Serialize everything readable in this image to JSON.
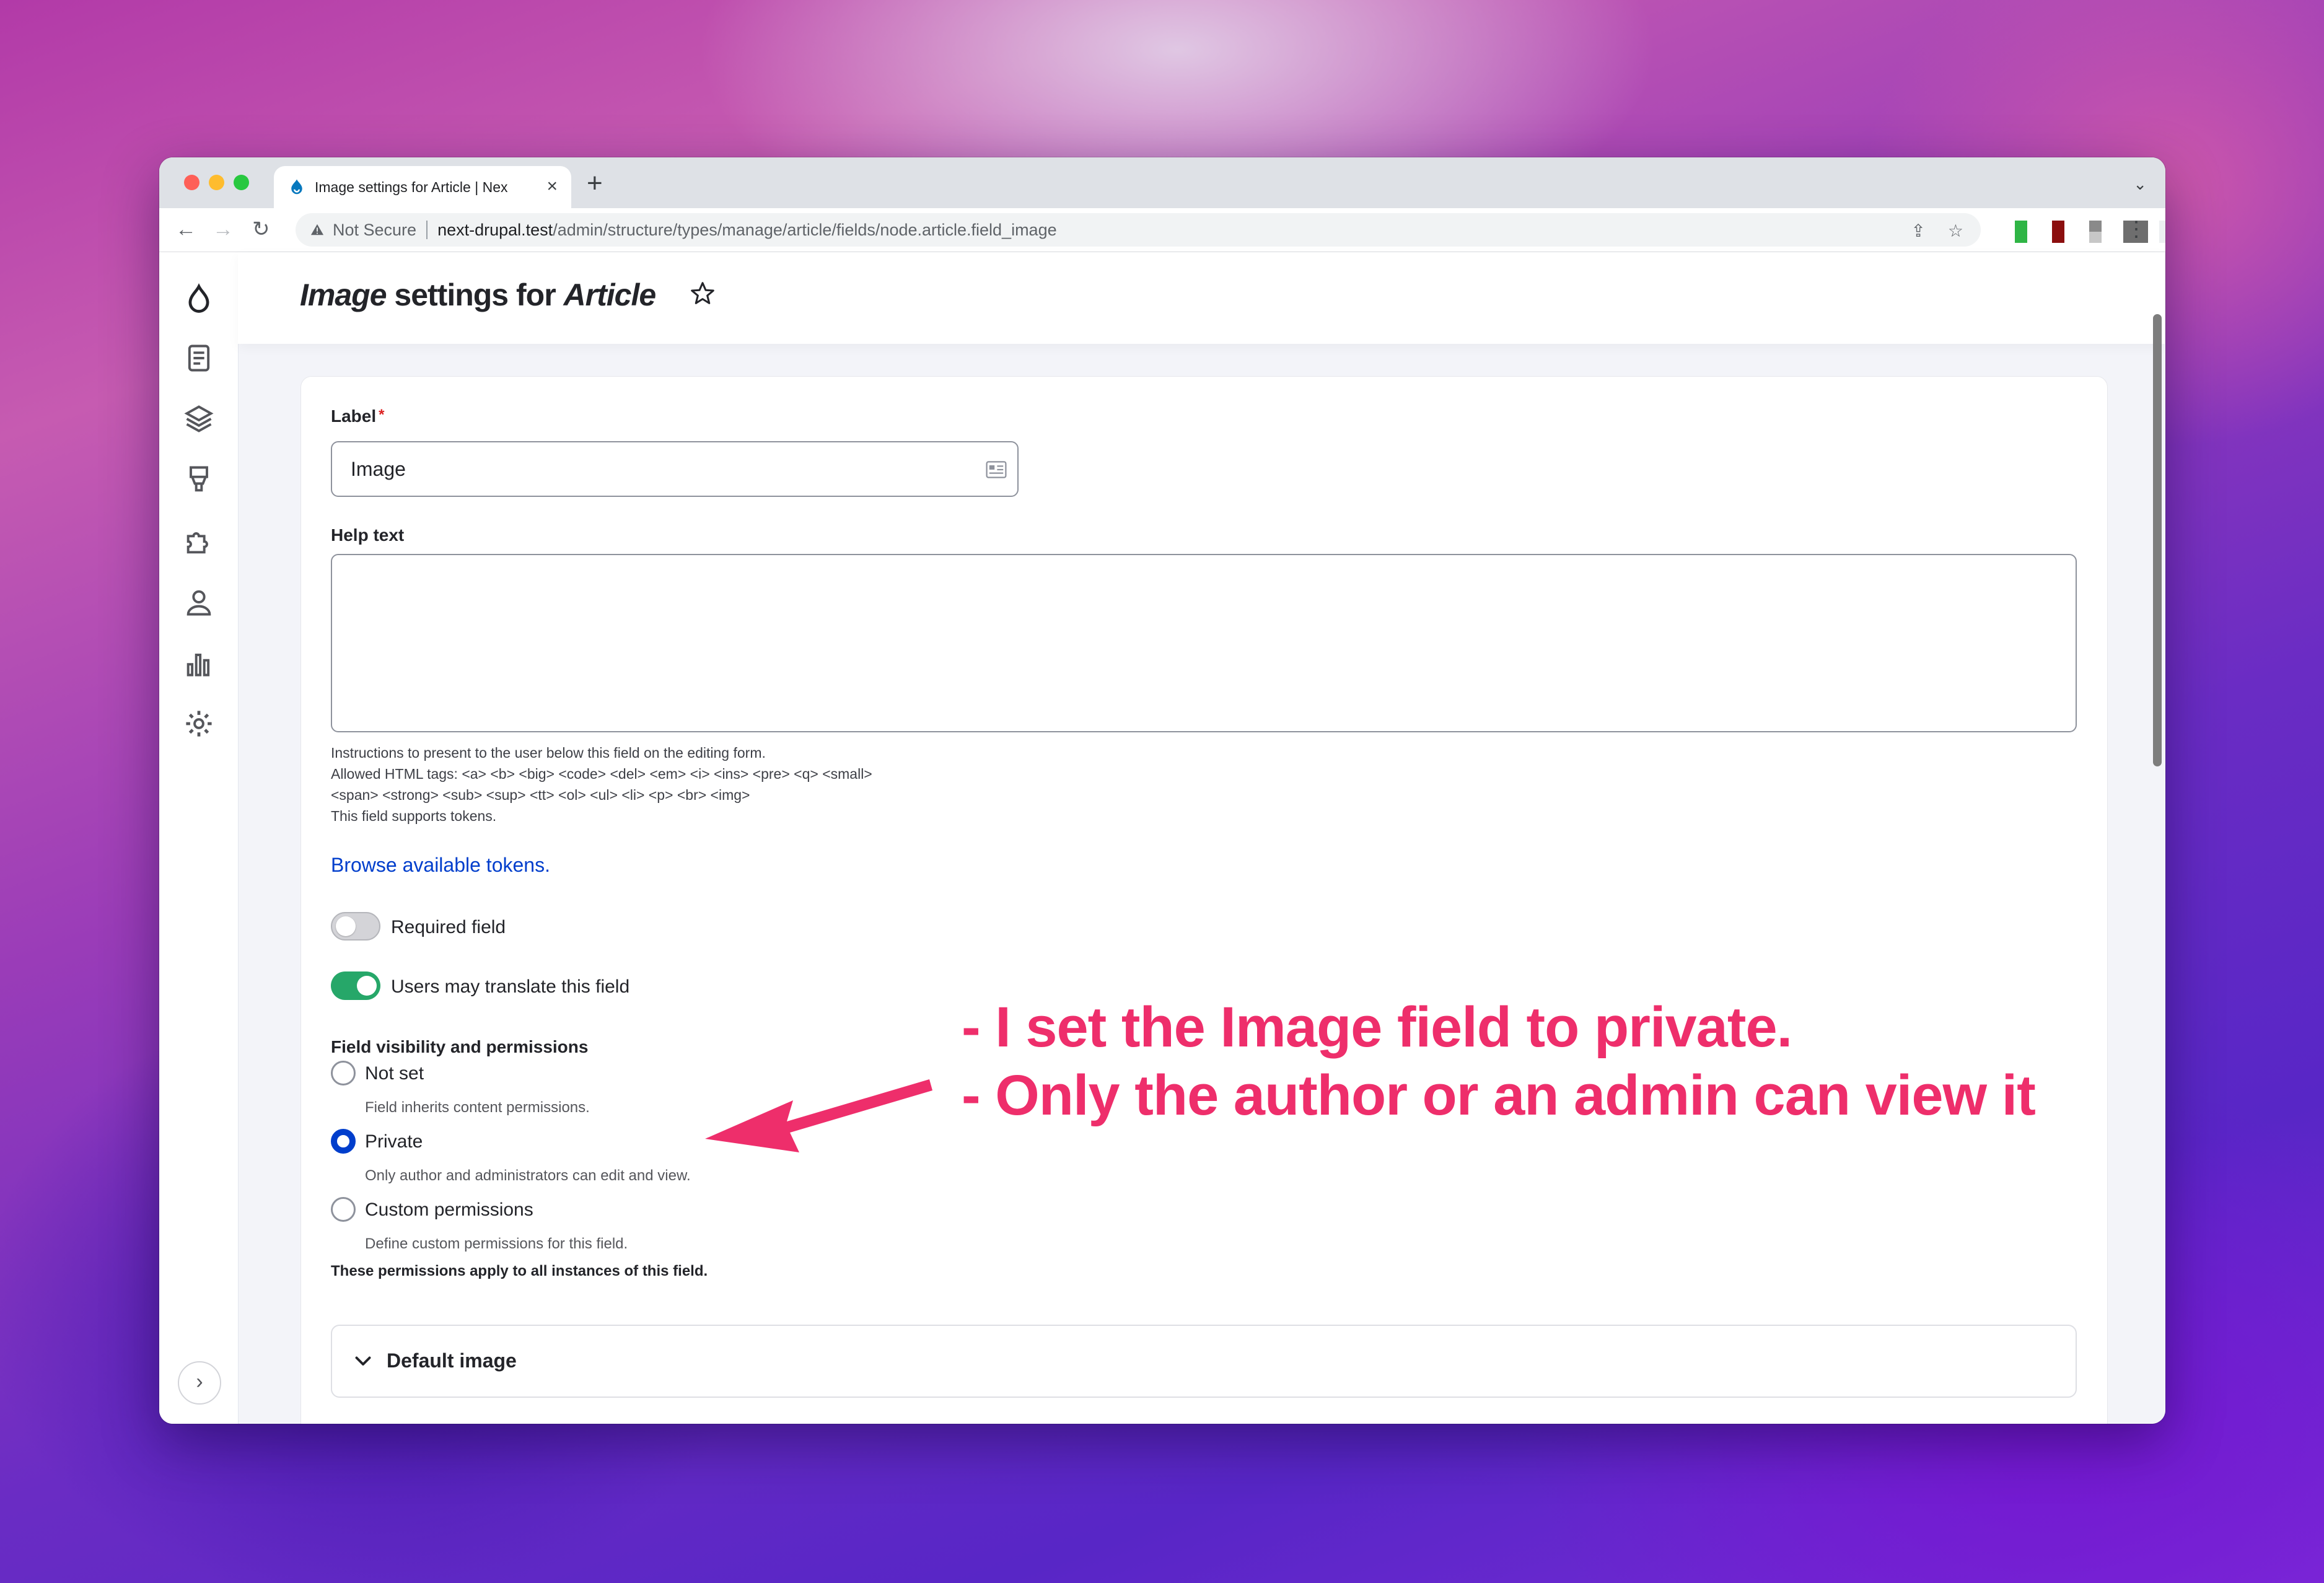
{
  "browser": {
    "tab_title": "Image settings for Article | Nex",
    "security_label": "Not Secure",
    "url_host": "next-drupal.test",
    "url_path": "/admin/structure/types/manage/article/fields/node.article.field_image",
    "extension_colors": [
      "#2fb545",
      "#8b0e0e",
      "#8a8a8a",
      "#6e6e6e",
      "#eceff1"
    ]
  },
  "page": {
    "title_italic_1": "Image",
    "title_middle": " settings for ",
    "title_italic_2": "Article"
  },
  "sidebar": {
    "icons": [
      "drupal-logo-icon",
      "content-icon",
      "structure-icon",
      "appearance-icon",
      "extend-icon",
      "people-icon",
      "reports-icon",
      "configuration-icon"
    ],
    "expand_label": "›"
  },
  "form": {
    "label_title": "Label",
    "label_value": "Image",
    "help_text_title": "Help text",
    "help_desc_1": "Instructions to present to the user below this field on the editing form.",
    "help_desc_2": "Allowed HTML tags: <a> <b> <big> <code> <del> <em> <i> <ins> <pre> <q> <small>",
    "help_desc_3": "<span> <strong> <sub> <sup> <tt> <ol> <ul> <li> <p> <br> <img>",
    "help_desc_4": "This field supports tokens.",
    "tokens_link": "Browse available tokens.",
    "required_field": {
      "label": "Required field",
      "checked": false
    },
    "translate_field": {
      "label": "Users may translate this field",
      "checked": true
    },
    "visibility_title": "Field visibility and permissions",
    "visibility_options": [
      {
        "label": "Not set",
        "description": "Field inherits content permissions.",
        "selected": false
      },
      {
        "label": "Private",
        "description": "Only author and administrators can edit and view.",
        "selected": true
      },
      {
        "label": "Custom permissions",
        "description": "Define custom permissions for this field.",
        "selected": false
      }
    ],
    "permissions_note": "These permissions apply to all instances of this field.",
    "default_image_label": "Default image"
  },
  "annotation": {
    "line_1": "- I set the Image field to private.",
    "line_2": "- Only the author or an admin can view it",
    "color": "#ee2e6b"
  }
}
